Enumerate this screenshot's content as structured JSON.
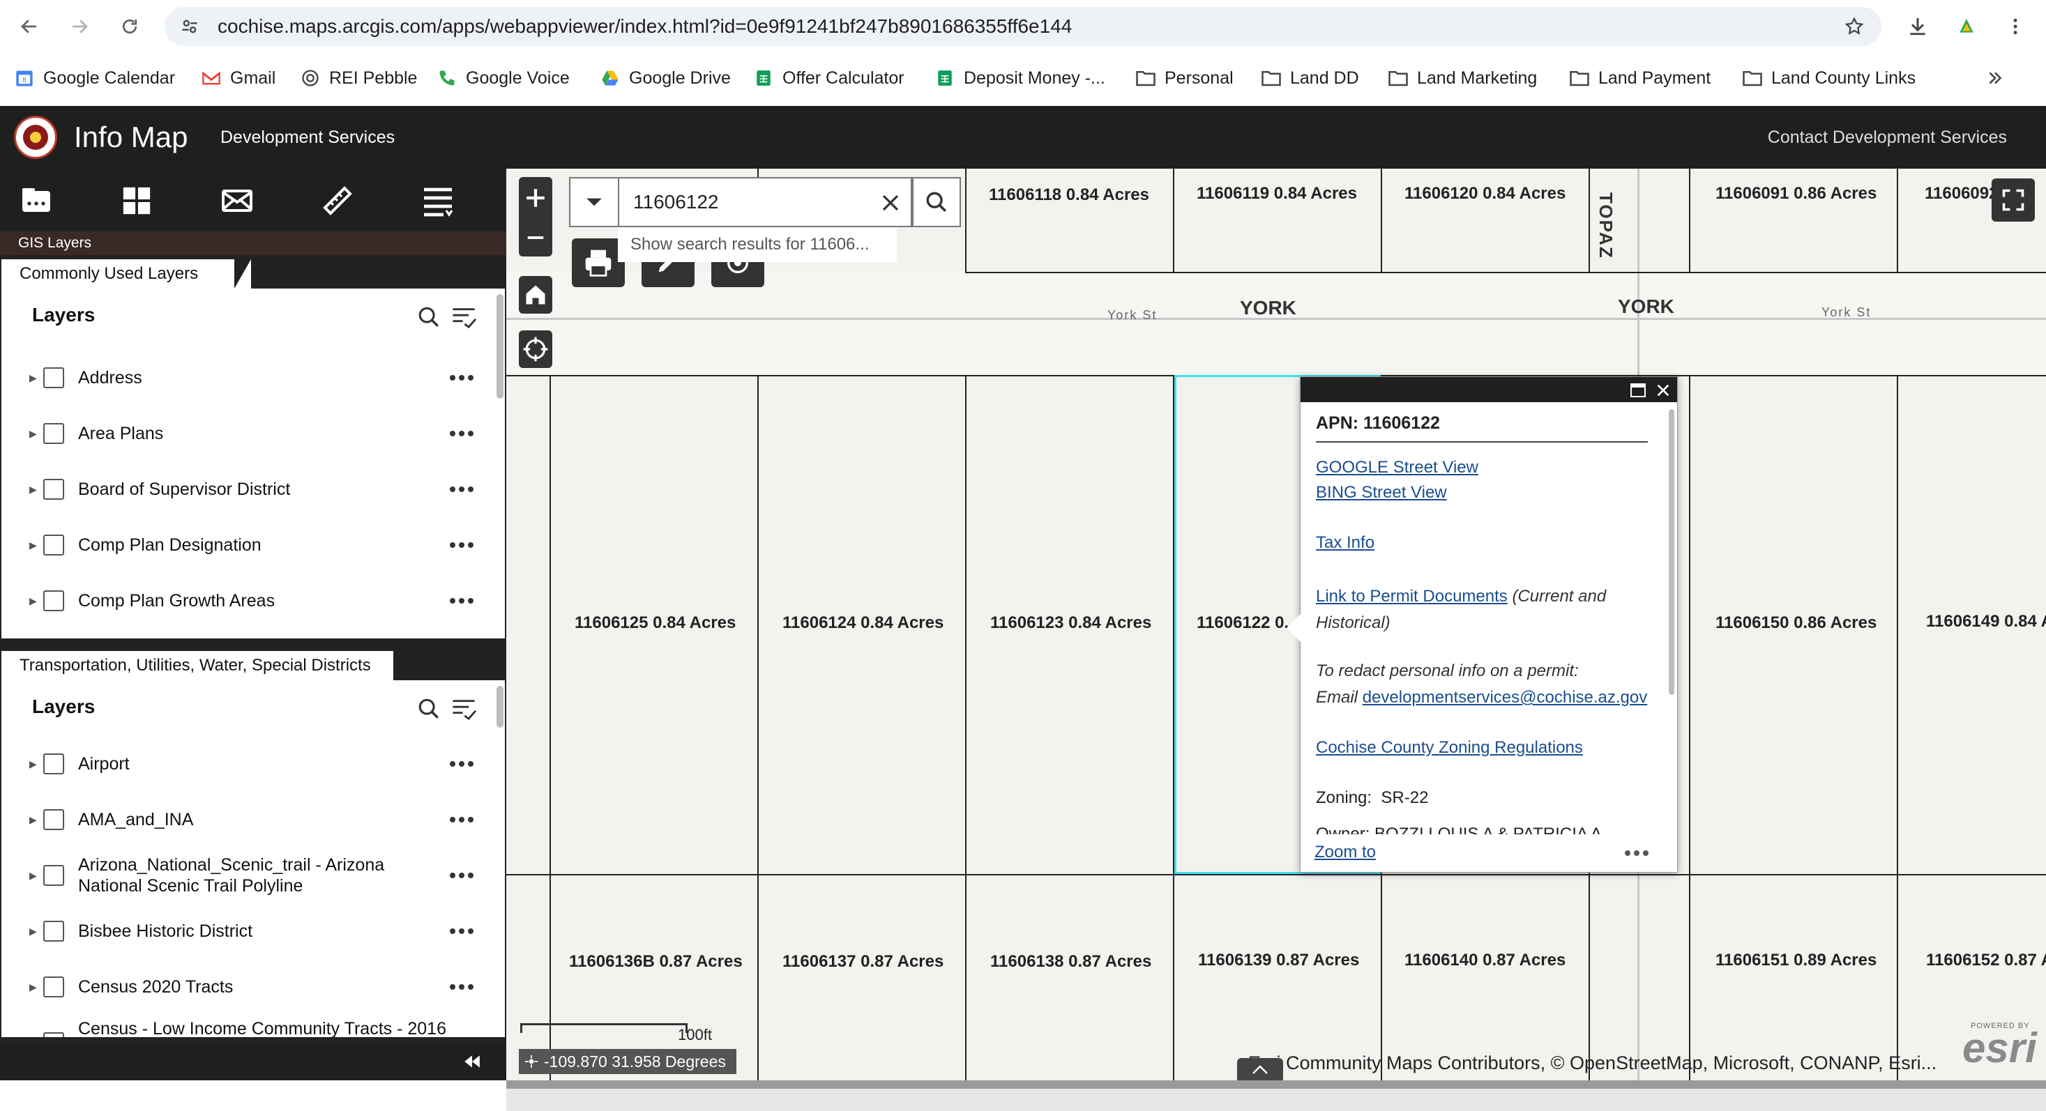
{
  "browser": {
    "url": "cochise.maps.arcgis.com/apps/webappviewer/index.html?id=0e9f91241bf247b8901686355ff6e144",
    "bookmarks": [
      {
        "label": "Google Calendar",
        "icon": "calendar-icon"
      },
      {
        "label": "Gmail",
        "icon": "gmail-icon"
      },
      {
        "label": "REI Pebble",
        "icon": "rei-icon"
      },
      {
        "label": "Google Voice",
        "icon": "phone-icon"
      },
      {
        "label": "Google Drive",
        "icon": "drive-icon"
      },
      {
        "label": "Offer Calculator",
        "icon": "sheets-icon"
      },
      {
        "label": "Deposit Money -...",
        "icon": "sheets-icon"
      },
      {
        "label": "Personal",
        "icon": "folder-icon"
      },
      {
        "label": "Land DD",
        "icon": "folder-icon"
      },
      {
        "label": "Land Marketing",
        "icon": "folder-icon"
      },
      {
        "label": "Land Payment",
        "icon": "folder-icon"
      },
      {
        "label": "Land County Links",
        "icon": "folder-icon"
      }
    ]
  },
  "app": {
    "title": "Info Map",
    "subtitle": "Development Services",
    "contact": "Contact Development Services"
  },
  "sidebar": {
    "section_label": "GIS Layers",
    "panel1": {
      "tab": "Commonly Used Layers",
      "heading": "Layers",
      "layers": [
        "Address",
        "Area Plans",
        "Board of Supervisor District",
        "Comp Plan Designation",
        "Comp Plan Growth Areas"
      ]
    },
    "panel2": {
      "tab": "Transportation, Utilities, Water, Special Districts",
      "heading": "Layers",
      "layers": [
        "Airport",
        "AMA_and_INA",
        "Arizona_National_Scenic_trail - Arizona National Scenic Trail Polyline",
        "Bisbee Historic District",
        "Census 2020 Tracts",
        "Census - Low Income Community Tracts - 2016"
      ]
    }
  },
  "search": {
    "value": "11606122",
    "suggestion": "Show search results for 11606..."
  },
  "map": {
    "streets": {
      "york_main": "YORK",
      "york_small": "York St",
      "topaz": "TOPAZ"
    },
    "parcels_top": [
      "11606118 0.84 Acres",
      "11606119 0.84 Acres",
      "11606120 0.84 Acres",
      "11606091 0.86 Acres",
      "11606092"
    ],
    "parcels_mid": [
      "11606125 0.84 Acres",
      "11606124 0.84 Acres",
      "11606123 0.84 Acres",
      "11606122 0.",
      "11606150 0.86 Acres",
      "11606149 0.84 A"
    ],
    "parcels_bot": [
      "11606136B 0.87 Acres",
      "11606137 0.87 Acres",
      "11606138 0.87 Acres",
      "11606139 0.87 Acres",
      "11606140 0.87 Acres",
      "11606151 0.89 Acres",
      "11606152 0.87 A"
    ],
    "scale_label": "100ft",
    "coords": "-109.870 31.958 Degrees",
    "attribution": "Esri Community Maps Contributors, © OpenStreetMap, Microsoft, CONANP, Esri...",
    "esri_label": "esri",
    "esri_powered": "POWERED BY"
  },
  "popup": {
    "title": "APN: 11606122",
    "google_sv": "GOOGLE Street View",
    "bing_sv": "BING Street View",
    "tax_info": "Tax Info",
    "permit_link": "Link to Permit Documents",
    "permit_note": "(Current and Historical)",
    "redact_line1": "To redact personal info on a permit:",
    "redact_email_prefix": "Email",
    "redact_email": "developmentservices@cochise.az.gov",
    "zoning_regs": "Cochise County Zoning Regulations",
    "zoning_label": "Zoning:",
    "zoning_value": "SR-22",
    "owner_partial": "Owner: BOZZI LOUIS A & PATRICIA A",
    "zoom_to": "Zoom to"
  },
  "colors": {
    "app_bar": "#1f1f1f",
    "link": "#1a4d8f",
    "selection": "#40e0f0"
  }
}
